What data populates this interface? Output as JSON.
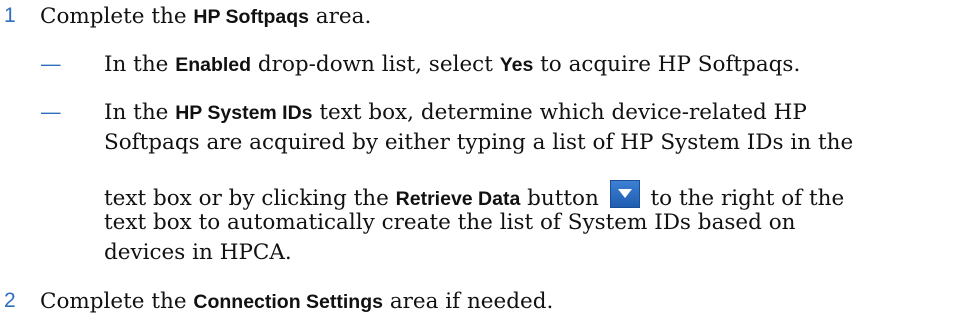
{
  "steps": [
    {
      "number": "1",
      "text_a": "Complete the ",
      "bold": "HP Softpaqs",
      "text_b": " area.",
      "substeps": [
        {
          "dash": "—",
          "a": "In the ",
          "b1": "Enabled",
          "c": " drop-down list, select ",
          "b2": "Yes",
          "d": " to acquire HP Softpaqs."
        },
        {
          "dash": "—",
          "line1_a": "In the ",
          "line1_bold": "HP System IDs",
          "line1_b": " text box, determine which device-related HP",
          "line2": "Softpaqs are acquired by either typing a list of HP System IDs in the",
          "line3_a": "text box or by clicking the ",
          "line3_bold": "Retrieve Data",
          "line3_b": " button ",
          "line3_c": " to the right of the",
          "line4": "text box to automatically create the list of System IDs based on",
          "line5": "devices in HPCA."
        }
      ]
    },
    {
      "number": "2",
      "text_a": "Complete the ",
      "bold": "Connection Settings",
      "text_b": " area if needed."
    }
  ],
  "icons": {
    "retrieve_data": "dropdown-arrow-icon"
  },
  "colors": {
    "accent": "#2f6fbf",
    "button": "#2b6cc4"
  }
}
